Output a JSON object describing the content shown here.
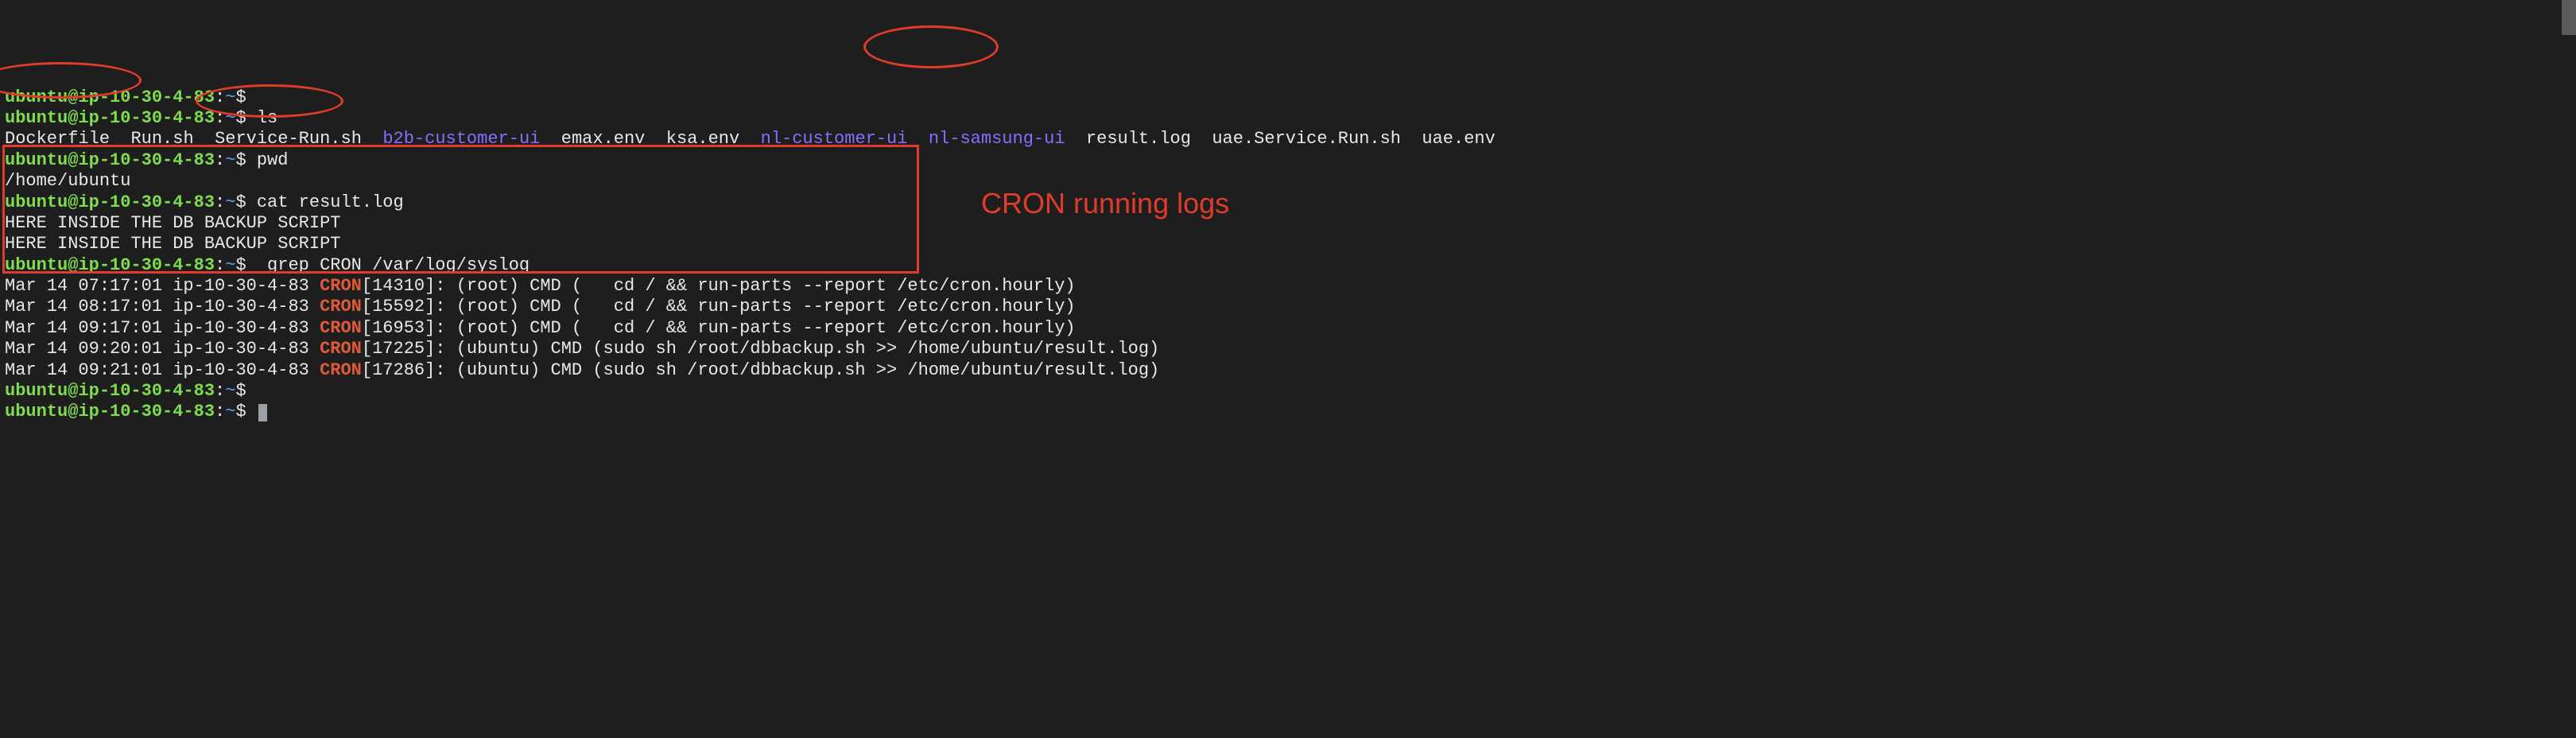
{
  "prompt": {
    "user_host": "ubuntu@ip-10-30-4-83",
    "colon": ":",
    "tilde": "~",
    "dollar": "$"
  },
  "cmd": {
    "empty": "",
    "ls": "ls",
    "pwd": "pwd",
    "cat": "cat result.log",
    "grep": " grep CRON /var/log/syslog"
  },
  "ls_out": {
    "c0": "Dockerfile",
    "c1": "Run.sh",
    "c2": "Service-Run.sh",
    "c3": "b2b-customer-ui",
    "c4": "emax.env",
    "c5": "ksa.env",
    "c6": "nl-customer-ui",
    "c7": "nl-samsung-ui",
    "c8": "result.log",
    "c9": "uae.Service.Run.sh",
    "c10": "uae.env"
  },
  "pwd_out": "/home/ubuntu",
  "cat_out": {
    "l0": "HERE INSIDE THE DB BACKUP SCRIPT",
    "l1": "HERE INSIDE THE DB BACKUP SCRIPT"
  },
  "cron": {
    "rows": [
      {
        "ts": "Mar 14 07:17:01",
        "host": "ip-10-30-4-83",
        "tag": "CRON",
        "rest": "[14310]: (root) CMD (   cd / && run-parts --report /etc/cron.hourly)"
      },
      {
        "ts": "Mar 14 08:17:01",
        "host": "ip-10-30-4-83",
        "tag": "CRON",
        "rest": "[15592]: (root) CMD (   cd / && run-parts --report /etc/cron.hourly)"
      },
      {
        "ts": "Mar 14 09:17:01",
        "host": "ip-10-30-4-83",
        "tag": "CRON",
        "rest": "[16953]: (root) CMD (   cd / && run-parts --report /etc/cron.hourly)"
      },
      {
        "ts": "Mar 14 09:20:01",
        "host": "ip-10-30-4-83",
        "tag": "CRON",
        "rest": "[17225]: (ubuntu) CMD (sudo sh /root/dbbackup.sh >> /home/ubuntu/result.log)"
      },
      {
        "ts": "Mar 14 09:21:01",
        "host": "ip-10-30-4-83",
        "tag": "CRON",
        "rest": "[17286]: (ubuntu) CMD (sudo sh /root/dbbackup.sh >> /home/ubuntu/result.log)"
      }
    ]
  },
  "annotation": "CRON running logs"
}
